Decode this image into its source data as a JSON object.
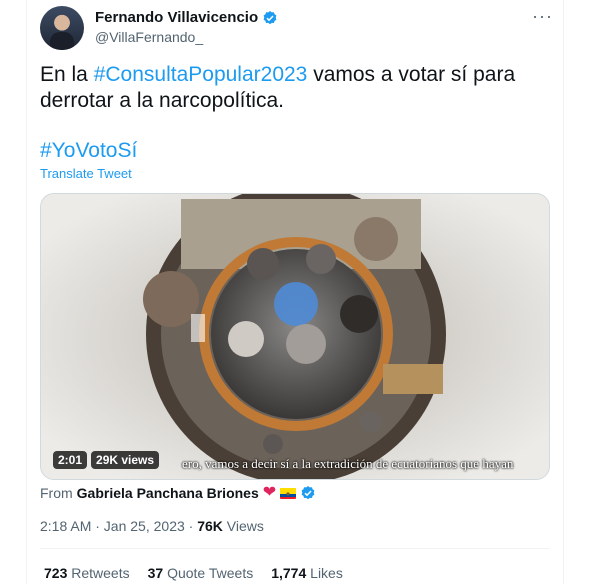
{
  "author": {
    "name": "Fernando Villavicencio",
    "handle": "@VillaFernando_",
    "verified": true
  },
  "menu": {
    "more_glyph": "···"
  },
  "tweet": {
    "text_prefix": "En la ",
    "hashtag_inline": "#ConsultaPopular2023",
    "text_suffix": " vamos a votar sí para derrotar a la narcopolítica.",
    "hashtag": "#YoVotoSí",
    "translate_label": "Translate Tweet"
  },
  "media": {
    "duration": "2:01",
    "views_badge": "29K views",
    "subtitle": "ero, vamos a decir sí a la extradición de ecuatorianos que hayan"
  },
  "source": {
    "from_label": "From",
    "author": "Gabriela Panchana Briones",
    "heart": "❤"
  },
  "meta": {
    "timestamp": "2:18 AM · Jan 25, 2023 · ",
    "views_count": "76K",
    "views_label": " Views"
  },
  "stats": {
    "retweets_count": "723",
    "retweets_label": "Retweets",
    "quotes_count": "37",
    "quotes_label": "Quote Tweets",
    "likes_count": "1,774",
    "likes_label": "Likes"
  },
  "colors": {
    "accent": "#1d9bf0",
    "text": "#0f1419",
    "muted": "#536471"
  }
}
